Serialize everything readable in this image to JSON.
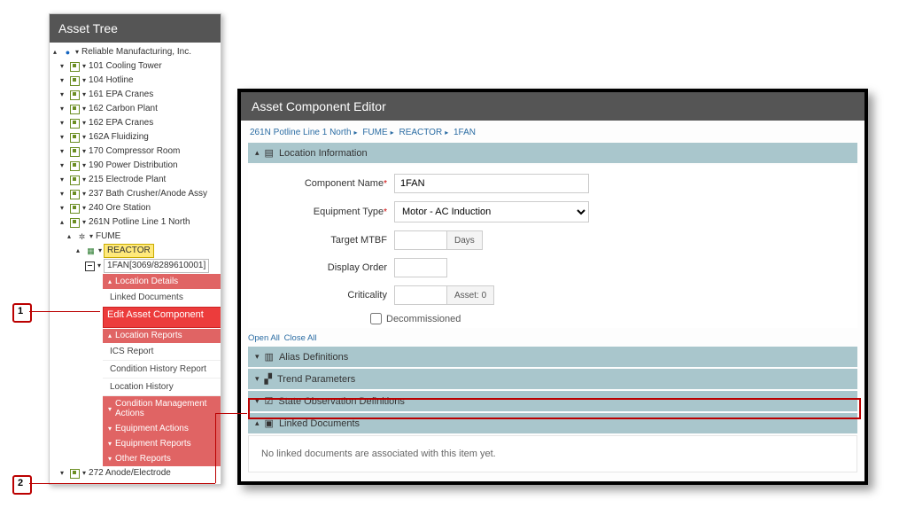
{
  "tree": {
    "title": "Asset Tree",
    "root": "Reliable Manufacturing, Inc.",
    "items": [
      "101 Cooling Tower",
      "104 Hotline",
      "161 EPA Cranes",
      "162 Carbon Plant",
      "162 EPA Cranes",
      "162A Fluidizing",
      "170 Compressor Room",
      "190 Power Distribution",
      "215 Electrode Plant",
      "237 Bath Crusher/Anode Assy",
      "240 Ore Station",
      "261N Potline Line 1 North"
    ],
    "fume": "FUME",
    "reactor": "REACTOR",
    "component": "1FAN[3069/8289610001]",
    "tail": "272 Anode/Electrode",
    "ctx": {
      "sec1": "Location Details",
      "linked": "Linked Documents",
      "edit": "Edit Asset Component",
      "sec2": "Location Reports",
      "ics": "ICS Report",
      "chr": "Condition History Report",
      "loc": "Location History",
      "sec3": "Condition Management Actions",
      "sec4": "Equipment Actions",
      "sec5": "Equipment Reports",
      "sec6": "Other Reports"
    }
  },
  "editor": {
    "title": "Asset Component Editor",
    "crumbs": [
      "261N Potline Line 1 North",
      "FUME",
      "REACTOR",
      "1FAN"
    ],
    "sec_loc": "Location Information",
    "fields": {
      "name_lbl": "Component Name",
      "name_val": "1FAN",
      "type_lbl": "Equipment Type",
      "type_val": "Motor - AC Induction",
      "mtbf_lbl": "Target MTBF",
      "mtbf_val": "",
      "mtbf_unit": "Days",
      "order_lbl": "Display Order",
      "order_val": "",
      "crit_lbl": "Criticality",
      "crit_val": "",
      "crit_addon": "Asset: 0",
      "decom": "Decommissioned"
    },
    "open_all": "Open All",
    "close_all": "Close All",
    "acc": {
      "alias": "Alias Definitions",
      "trend": "Trend Parameters",
      "state": "State Observation Definitions",
      "linked": "Linked Documents"
    },
    "linked_empty": "No linked documents are associated with this item yet."
  },
  "callouts": {
    "one": "1",
    "two": "2"
  }
}
